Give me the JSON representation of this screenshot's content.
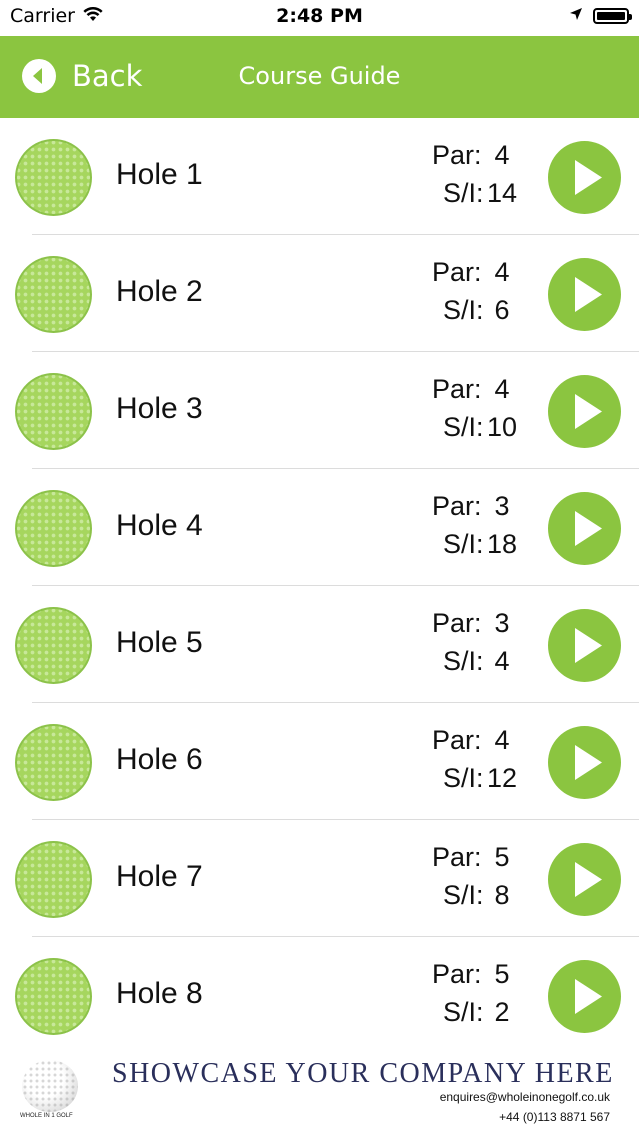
{
  "status_bar": {
    "carrier": "Carrier",
    "time": "2:48 PM"
  },
  "nav": {
    "back_label": "Back",
    "title": "Course Guide"
  },
  "labels": {
    "par": "Par:",
    "si": "S/I:"
  },
  "holes": [
    {
      "name": "Hole 1",
      "par": "4",
      "si": "14"
    },
    {
      "name": "Hole 2",
      "par": "4",
      "si": "6"
    },
    {
      "name": "Hole 3",
      "par": "4",
      "si": "10"
    },
    {
      "name": "Hole 4",
      "par": "3",
      "si": "18"
    },
    {
      "name": "Hole 5",
      "par": "3",
      "si": "4"
    },
    {
      "name": "Hole 6",
      "par": "4",
      "si": "12"
    },
    {
      "name": "Hole 7",
      "par": "5",
      "si": "8"
    },
    {
      "name": "Hole 8",
      "par": "5",
      "si": "2"
    }
  ],
  "footer": {
    "brand": "WHOLE IN 1 GOLF",
    "showcase": "SHOWCASE YOUR COMPANY HERE",
    "email": "enquires@wholeinonegolf.co.uk",
    "phone": "+44 (0)113 8871 567"
  },
  "colors": {
    "accent": "#8bc540",
    "ball": "#a6d65e",
    "showcase_text": "#2a2f5b"
  },
  "icons": {
    "back": "chevron-left-circle-icon",
    "play": "play-icon",
    "ball": "golf-ball-icon",
    "wifi": "wifi-icon",
    "location": "location-arrow-icon",
    "battery": "battery-icon"
  }
}
